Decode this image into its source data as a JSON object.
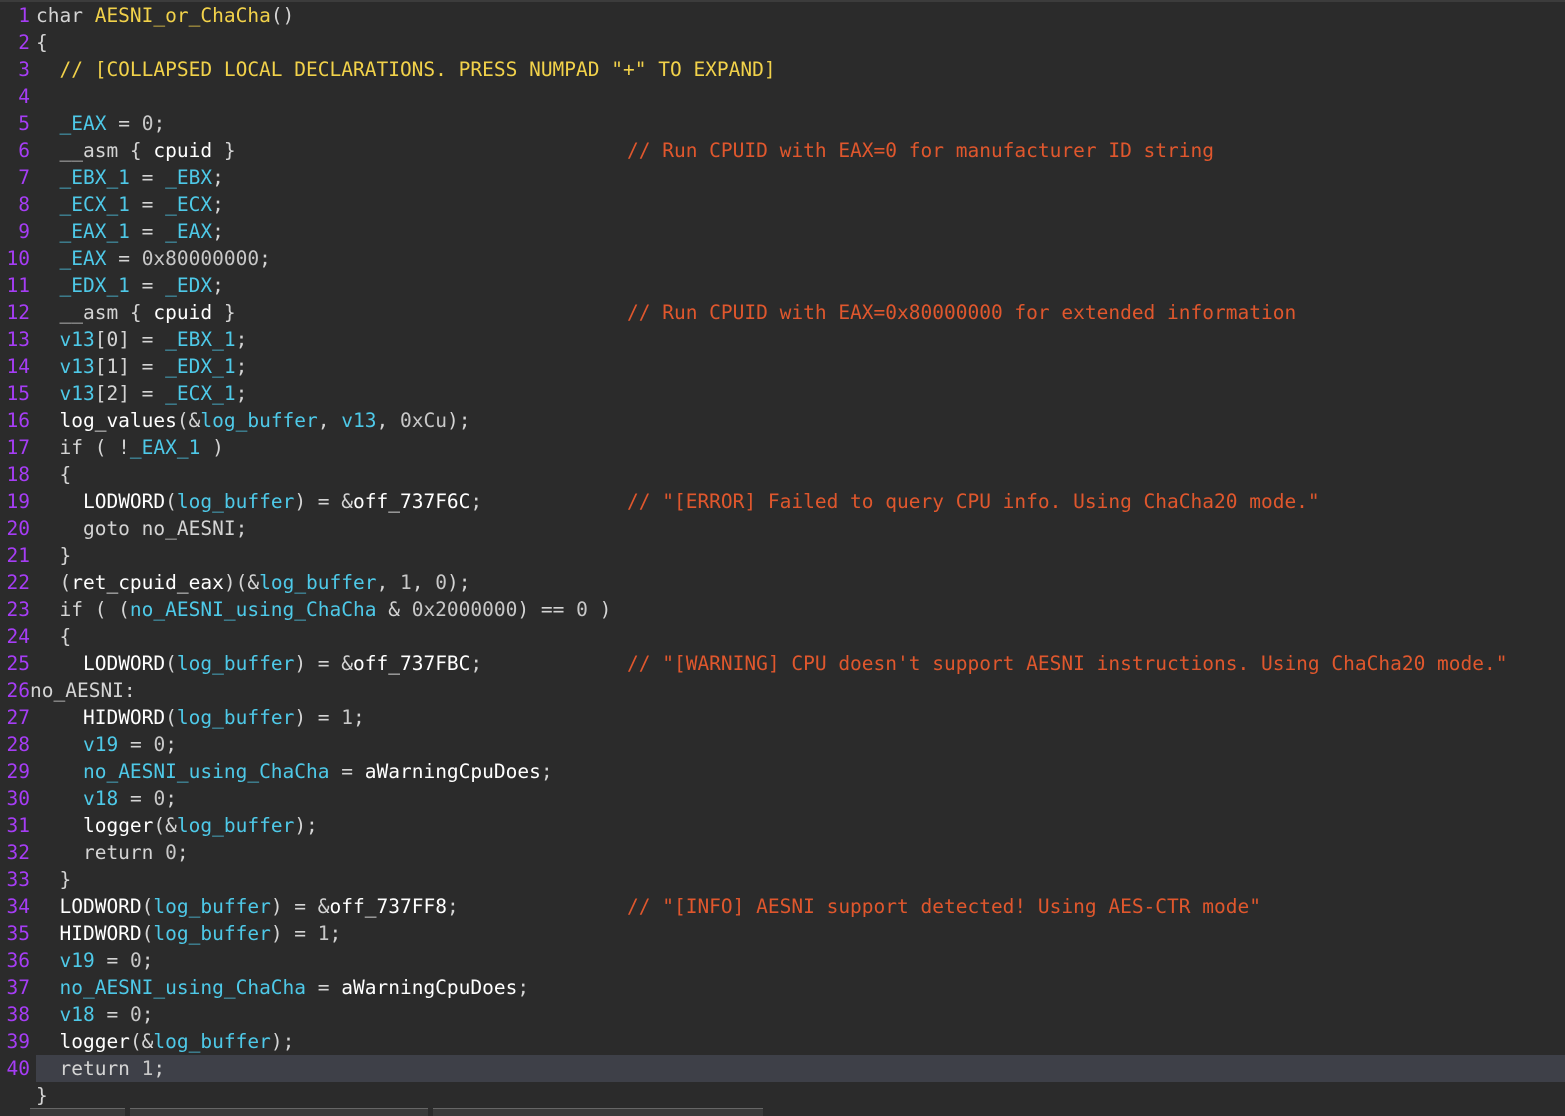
{
  "editor": {
    "function_signature": "char AESNI_or_ChaCha()",
    "lines": [
      {
        "n": "1",
        "tokens": [
          [
            "char ",
            "t-plain"
          ],
          [
            "AESNI_or_ChaCha",
            "t-func"
          ],
          [
            "()",
            "t-plain"
          ]
        ]
      },
      {
        "n": "2",
        "tokens": [
          [
            "{",
            "t-plain"
          ]
        ]
      },
      {
        "n": "3",
        "tokens": [
          [
            "  // [COLLAPSED LOCAL DECLARATIONS. PRESS NUMPAD \"+\" TO EXPAND]",
            "t-coll"
          ]
        ]
      },
      {
        "n": "4",
        "tokens": []
      },
      {
        "n": "5",
        "tokens": [
          [
            "  ",
            "t-plain"
          ],
          [
            "_EAX",
            "t-var"
          ],
          [
            " = ",
            "t-plain"
          ],
          [
            "0",
            "t-num"
          ],
          [
            ";",
            "t-plain"
          ]
        ]
      },
      {
        "n": "6",
        "tokens": [
          [
            "  __asm { ",
            "t-plain"
          ],
          [
            "cpuid",
            "t-white"
          ],
          [
            " }",
            "t-plain"
          ]
        ],
        "comment": "// Run CPUID with EAX=0 for manufacturer ID string"
      },
      {
        "n": "7",
        "tokens": [
          [
            "  ",
            "t-plain"
          ],
          [
            "_EBX_1",
            "t-var"
          ],
          [
            " = ",
            "t-plain"
          ],
          [
            "_EBX",
            "t-var"
          ],
          [
            ";",
            "t-plain"
          ]
        ]
      },
      {
        "n": "8",
        "tokens": [
          [
            "  ",
            "t-plain"
          ],
          [
            "_ECX_1",
            "t-var"
          ],
          [
            " = ",
            "t-plain"
          ],
          [
            "_ECX",
            "t-var"
          ],
          [
            ";",
            "t-plain"
          ]
        ]
      },
      {
        "n": "9",
        "tokens": [
          [
            "  ",
            "t-plain"
          ],
          [
            "_EAX_1",
            "t-var"
          ],
          [
            " = ",
            "t-plain"
          ],
          [
            "_EAX",
            "t-var"
          ],
          [
            ";",
            "t-plain"
          ]
        ]
      },
      {
        "n": "10",
        "tokens": [
          [
            "  ",
            "t-plain"
          ],
          [
            "_EAX",
            "t-var"
          ],
          [
            " = ",
            "t-plain"
          ],
          [
            "0x80000000",
            "t-num"
          ],
          [
            ";",
            "t-plain"
          ]
        ]
      },
      {
        "n": "11",
        "tokens": [
          [
            "  ",
            "t-plain"
          ],
          [
            "_EDX_1",
            "t-var"
          ],
          [
            " = ",
            "t-plain"
          ],
          [
            "_EDX",
            "t-var"
          ],
          [
            ";",
            "t-plain"
          ]
        ]
      },
      {
        "n": "12",
        "tokens": [
          [
            "  __asm { ",
            "t-plain"
          ],
          [
            "cpuid",
            "t-white"
          ],
          [
            " }",
            "t-plain"
          ]
        ],
        "comment": "// Run CPUID with EAX=0x80000000 for extended information"
      },
      {
        "n": "13",
        "tokens": [
          [
            "  ",
            "t-plain"
          ],
          [
            "v13",
            "t-var"
          ],
          [
            "[0] = ",
            "t-plain"
          ],
          [
            "_EBX_1",
            "t-var"
          ],
          [
            ";",
            "t-plain"
          ]
        ]
      },
      {
        "n": "14",
        "tokens": [
          [
            "  ",
            "t-plain"
          ],
          [
            "v13",
            "t-var"
          ],
          [
            "[1] = ",
            "t-plain"
          ],
          [
            "_EDX_1",
            "t-var"
          ],
          [
            ";",
            "t-plain"
          ]
        ]
      },
      {
        "n": "15",
        "tokens": [
          [
            "  ",
            "t-plain"
          ],
          [
            "v13",
            "t-var"
          ],
          [
            "[2] = ",
            "t-plain"
          ],
          [
            "_ECX_1",
            "t-var"
          ],
          [
            ";",
            "t-plain"
          ]
        ]
      },
      {
        "n": "16",
        "tokens": [
          [
            "  ",
            "t-plain"
          ],
          [
            "log_values",
            "t-white"
          ],
          [
            "(&",
            "t-plain"
          ],
          [
            "log_buffer",
            "t-var"
          ],
          [
            ", ",
            "t-plain"
          ],
          [
            "v13",
            "t-var"
          ],
          [
            ", ",
            "t-plain"
          ],
          [
            "0xCu",
            "t-num"
          ],
          [
            ");",
            "t-plain"
          ]
        ]
      },
      {
        "n": "17",
        "tokens": [
          [
            "  if ( !",
            "t-plain"
          ],
          [
            "_EAX_1",
            "t-var"
          ],
          [
            " )",
            "t-plain"
          ]
        ]
      },
      {
        "n": "18",
        "tokens": [
          [
            "  {",
            "t-plain"
          ]
        ]
      },
      {
        "n": "19",
        "tokens": [
          [
            "    ",
            "t-plain"
          ],
          [
            "LODWORD",
            "t-white"
          ],
          [
            "(",
            "t-plain"
          ],
          [
            "log_buffer",
            "t-var"
          ],
          [
            ") = &",
            "t-plain"
          ],
          [
            "off_737F6C",
            "t-white"
          ],
          [
            ";",
            "t-plain"
          ]
        ],
        "comment": "// \"[ERROR] Failed to query CPU info. Using ChaCha20 mode.\""
      },
      {
        "n": "20",
        "tokens": [
          [
            "    goto no_AESNI;",
            "t-plain"
          ]
        ]
      },
      {
        "n": "21",
        "tokens": [
          [
            "  }",
            "t-plain"
          ]
        ]
      },
      {
        "n": "22",
        "tokens": [
          [
            "  (",
            "t-plain"
          ],
          [
            "ret_cpuid_eax",
            "t-white"
          ],
          [
            ")(&",
            "t-plain"
          ],
          [
            "log_buffer",
            "t-var"
          ],
          [
            ", ",
            "t-plain"
          ],
          [
            "1",
            "t-num"
          ],
          [
            ", ",
            "t-plain"
          ],
          [
            "0",
            "t-num"
          ],
          [
            ");",
            "t-plain"
          ]
        ]
      },
      {
        "n": "23",
        "tokens": [
          [
            "  if ( (",
            "t-plain"
          ],
          [
            "no_AESNI_using_ChaCha",
            "t-var"
          ],
          [
            " & ",
            "t-plain"
          ],
          [
            "0x2000000",
            "t-num"
          ],
          [
            ") == ",
            "t-plain"
          ],
          [
            "0",
            "t-num"
          ],
          [
            " )",
            "t-plain"
          ]
        ]
      },
      {
        "n": "24",
        "tokens": [
          [
            "  {",
            "t-plain"
          ]
        ]
      },
      {
        "n": "25",
        "tokens": [
          [
            "    ",
            "t-plain"
          ],
          [
            "LODWORD",
            "t-white"
          ],
          [
            "(",
            "t-plain"
          ],
          [
            "log_buffer",
            "t-var"
          ],
          [
            ") = &",
            "t-plain"
          ],
          [
            "off_737FBC",
            "t-white"
          ],
          [
            ";",
            "t-plain"
          ]
        ],
        "comment": "// \"[WARNING] CPU doesn't support AESNI instructions. Using ChaCha20 mode.\""
      },
      {
        "n": "26",
        "tokens": [
          [
            "no_AESNI:",
            "t-plain"
          ]
        ],
        "label": true
      },
      {
        "n": "27",
        "tokens": [
          [
            "    ",
            "t-plain"
          ],
          [
            "HIDWORD",
            "t-white"
          ],
          [
            "(",
            "t-plain"
          ],
          [
            "log_buffer",
            "t-var"
          ],
          [
            ") = ",
            "t-plain"
          ],
          [
            "1",
            "t-num"
          ],
          [
            ";",
            "t-plain"
          ]
        ]
      },
      {
        "n": "28",
        "tokens": [
          [
            "    ",
            "t-plain"
          ],
          [
            "v19",
            "t-var"
          ],
          [
            " = ",
            "t-plain"
          ],
          [
            "0",
            "t-num"
          ],
          [
            ";",
            "t-plain"
          ]
        ]
      },
      {
        "n": "29",
        "tokens": [
          [
            "    ",
            "t-plain"
          ],
          [
            "no_AESNI_using_ChaCha",
            "t-var"
          ],
          [
            " = ",
            "t-plain"
          ],
          [
            "aWarningCpuDoes",
            "t-white"
          ],
          [
            ";",
            "t-plain"
          ]
        ]
      },
      {
        "n": "30",
        "tokens": [
          [
            "    ",
            "t-plain"
          ],
          [
            "v18",
            "t-var"
          ],
          [
            " = ",
            "t-plain"
          ],
          [
            "0",
            "t-num"
          ],
          [
            ";",
            "t-plain"
          ]
        ]
      },
      {
        "n": "31",
        "tokens": [
          [
            "    ",
            "t-plain"
          ],
          [
            "logger",
            "t-white"
          ],
          [
            "(&",
            "t-plain"
          ],
          [
            "log_buffer",
            "t-var"
          ],
          [
            ");",
            "t-plain"
          ]
        ]
      },
      {
        "n": "32",
        "tokens": [
          [
            "    return ",
            "t-plain"
          ],
          [
            "0",
            "t-num"
          ],
          [
            ";",
            "t-plain"
          ]
        ]
      },
      {
        "n": "33",
        "tokens": [
          [
            "  }",
            "t-plain"
          ]
        ]
      },
      {
        "n": "34",
        "tokens": [
          [
            "  ",
            "t-plain"
          ],
          [
            "LODWORD",
            "t-white"
          ],
          [
            "(",
            "t-plain"
          ],
          [
            "log_buffer",
            "t-var"
          ],
          [
            ") = &",
            "t-plain"
          ],
          [
            "off_737FF8",
            "t-white"
          ],
          [
            ";",
            "t-plain"
          ]
        ],
        "comment": "// \"[INFO] AESNI support detected! Using AES-CTR mode\""
      },
      {
        "n": "35",
        "tokens": [
          [
            "  ",
            "t-plain"
          ],
          [
            "HIDWORD",
            "t-white"
          ],
          [
            "(",
            "t-plain"
          ],
          [
            "log_buffer",
            "t-var"
          ],
          [
            ") = ",
            "t-plain"
          ],
          [
            "1",
            "t-num"
          ],
          [
            ";",
            "t-plain"
          ]
        ]
      },
      {
        "n": "36",
        "tokens": [
          [
            "  ",
            "t-plain"
          ],
          [
            "v19",
            "t-var"
          ],
          [
            " = ",
            "t-plain"
          ],
          [
            "0",
            "t-num"
          ],
          [
            ";",
            "t-plain"
          ]
        ]
      },
      {
        "n": "37",
        "tokens": [
          [
            "  ",
            "t-plain"
          ],
          [
            "no_AESNI_using_ChaCha",
            "t-var"
          ],
          [
            " = ",
            "t-plain"
          ],
          [
            "aWarningCpuDoes",
            "t-white"
          ],
          [
            ";",
            "t-plain"
          ]
        ]
      },
      {
        "n": "38",
        "tokens": [
          [
            "  ",
            "t-plain"
          ],
          [
            "v18",
            "t-var"
          ],
          [
            " = ",
            "t-plain"
          ],
          [
            "0",
            "t-num"
          ],
          [
            ";",
            "t-plain"
          ]
        ]
      },
      {
        "n": "39",
        "tokens": [
          [
            "  ",
            "t-plain"
          ],
          [
            "logger",
            "t-white"
          ],
          [
            "(&",
            "t-plain"
          ],
          [
            "log_buffer",
            "t-var"
          ],
          [
            ");",
            "t-plain"
          ]
        ]
      },
      {
        "n": "40",
        "tokens": [
          [
            "  return ",
            "t-plain"
          ],
          [
            "1",
            "t-num"
          ],
          [
            ";",
            "t-plain"
          ]
        ],
        "current": true
      },
      {
        "n": "",
        "tokens": [
          [
            "}",
            "t-plain"
          ]
        ]
      }
    ]
  },
  "colors": {
    "background": "#2b2b2b",
    "line_number": "#a63df5",
    "comment": "#e0572d",
    "function_name": "#f2d24a",
    "variable": "#4ec9e8",
    "current_line": "#3e4048"
  }
}
